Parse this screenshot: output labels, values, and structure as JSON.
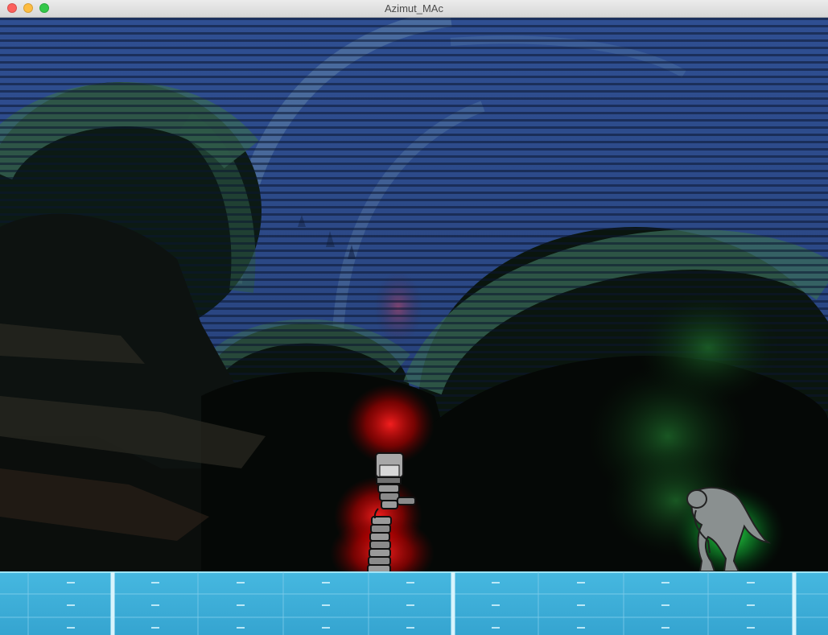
{
  "window": {
    "title": "Azimut_MAc",
    "close_color": "#fc605c",
    "minimize_color": "#fdbc40",
    "maximize_color": "#34c84a"
  },
  "scene": {
    "sky_color": "#2a4a8c",
    "floor_color": "#3db0d8",
    "player": {
      "name": "robot",
      "aura_color": "#ff1a1a"
    },
    "enemy": {
      "name": "creature",
      "aura_color": "#1aff3c"
    }
  }
}
